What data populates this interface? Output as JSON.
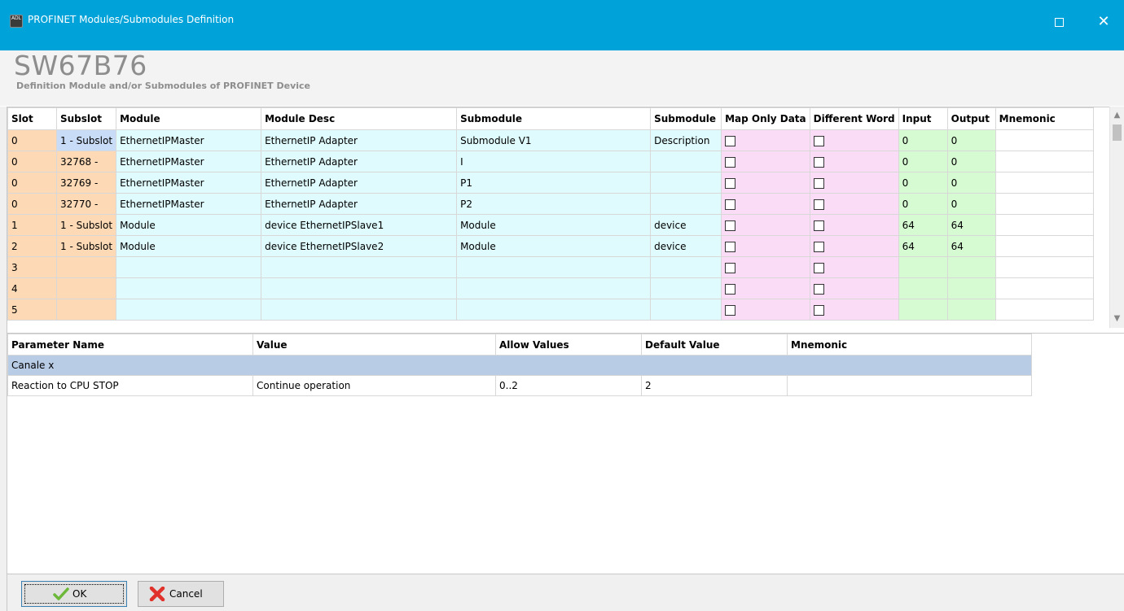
{
  "window": {
    "title": "PROFINET Modules/Submodules Definition",
    "icon": "app-icon",
    "icon_text": "ADL"
  },
  "header": {
    "title": "SW67B76",
    "subtitle": "Definition Module and/or Submodules of PROFINET Device"
  },
  "top_grid": {
    "columns": [
      "Slot",
      "Subslot",
      "Module",
      "Module Desc",
      "Submodule",
      "Submodule",
      "Map Only Data",
      "Different Word",
      "Input",
      "Output",
      "Mnemonic"
    ],
    "rows": [
      {
        "slot": "0",
        "subslot": "1 - Subslot",
        "module": "EthernetIPMaster",
        "module_desc": "EthernetIP Adapter",
        "submodule": "Submodule V1",
        "submodule_desc": "Description",
        "input": "0",
        "output": "0",
        "mnemonic": ""
      },
      {
        "slot": "0",
        "subslot": "32768 -",
        "module": "EthernetIPMaster",
        "module_desc": "EthernetIP Adapter",
        "submodule": "I",
        "submodule_desc": "",
        "input": "0",
        "output": "0",
        "mnemonic": ""
      },
      {
        "slot": "0",
        "subslot": "32769 -",
        "module": "EthernetIPMaster",
        "module_desc": "EthernetIP Adapter",
        "submodule": "P1",
        "submodule_desc": "",
        "input": "0",
        "output": "0",
        "mnemonic": ""
      },
      {
        "slot": "0",
        "subslot": "32770 -",
        "module": "EthernetIPMaster",
        "module_desc": "EthernetIP Adapter",
        "submodule": "P2",
        "submodule_desc": "",
        "input": "0",
        "output": "0",
        "mnemonic": ""
      },
      {
        "slot": "1",
        "subslot": "1 - Subslot",
        "module": "Module",
        "module_desc": "device EthernetIPSlave1",
        "submodule": "Module",
        "submodule_desc": "device",
        "input": "64",
        "output": "64",
        "mnemonic": ""
      },
      {
        "slot": "2",
        "subslot": "1 - Subslot",
        "module": "Module",
        "module_desc": "device EthernetIPSlave2",
        "submodule": "Module",
        "submodule_desc": "device",
        "input": "64",
        "output": "64",
        "mnemonic": ""
      },
      {
        "slot": "3",
        "subslot": "",
        "module": "",
        "module_desc": "",
        "submodule": "",
        "submodule_desc": "",
        "input": "",
        "output": "",
        "mnemonic": ""
      },
      {
        "slot": "4",
        "subslot": "",
        "module": "",
        "module_desc": "",
        "submodule": "",
        "submodule_desc": "",
        "input": "",
        "output": "",
        "mnemonic": ""
      },
      {
        "slot": "5",
        "subslot": "",
        "module": "",
        "module_desc": "",
        "submodule": "",
        "submodule_desc": "",
        "input": "",
        "output": "",
        "mnemonic": ""
      }
    ]
  },
  "bottom_grid": {
    "columns": [
      "Parameter Name",
      "Value",
      "Allow Values",
      "Default Value",
      "Mnemonic"
    ],
    "group_label": "Canale x",
    "rows": [
      {
        "name": "Reaction to CPU STOP",
        "value": "Continue operation",
        "allow": "0..2",
        "default": "2",
        "mnemonic": ""
      }
    ]
  },
  "footer": {
    "ok_label": "OK",
    "cancel_label": "Cancel"
  },
  "colors": {
    "titlebar": "#00a3d9",
    "slot_col": "#fdd9b5",
    "module_cols": "#dffbfd",
    "check_cols": "#fbdcf6",
    "io_cols": "#d6fbd3",
    "group_row": "#b9cce6"
  }
}
